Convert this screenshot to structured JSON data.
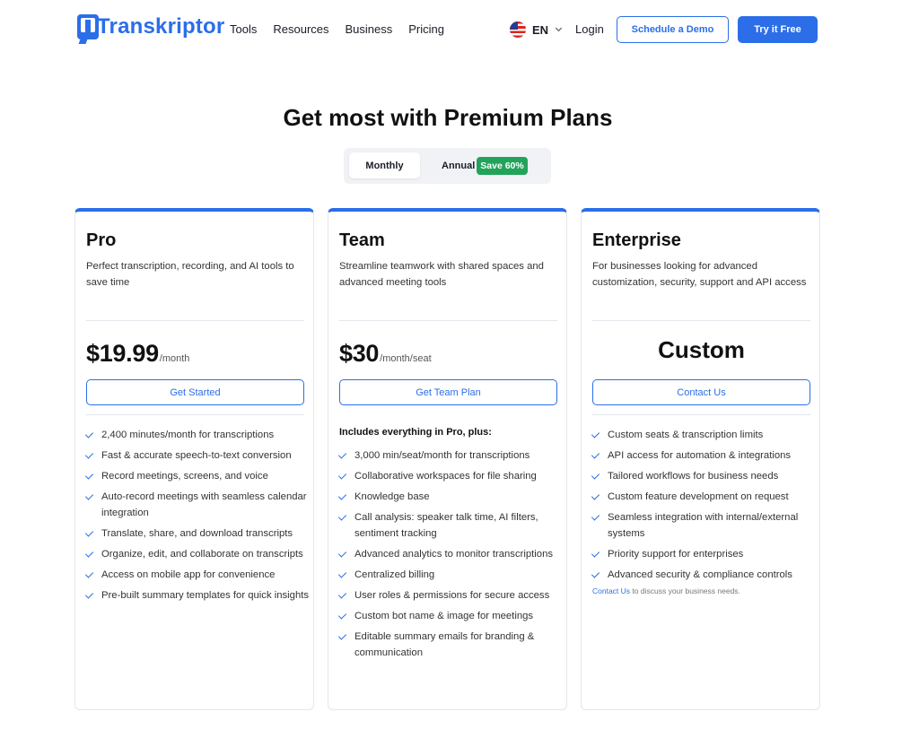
{
  "header": {
    "logo_text": "Transkriptor",
    "nav": [
      "Tools",
      "Resources",
      "Business",
      "Pricing"
    ],
    "language": "EN",
    "login": "Login",
    "demo_button": "Schedule a Demo",
    "try_button": "Try it Free",
    "accent_color": "#2b6ee8"
  },
  "hero": {
    "title": "Get most with Premium Plans",
    "toggle": {
      "monthly": "Monthly",
      "annual": "Annual",
      "save_badge": "Save 60%",
      "selected": "Monthly"
    }
  },
  "plans": [
    {
      "name": "Pro",
      "description": "Perfect transcription, recording, and AI tools to save time",
      "price": "$19.99",
      "unit": "/month",
      "cta": "Get Started",
      "features": [
        "2,400 minutes/month for transcriptions",
        "Fast & accurate speech-to-text conversion",
        "Record meetings, screens, and voice",
        "Auto-record meetings with seamless calendar integration",
        "Translate, share, and download transcripts",
        "Organize, edit, and collaborate on transcripts",
        "Access on mobile app for convenience",
        "Pre-built summary templates for quick insights"
      ]
    },
    {
      "name": "Team",
      "description": "Streamline teamwork with shared spaces and advanced meeting tools",
      "price": "$30",
      "unit": "/month/seat",
      "cta": "Get Team Plan",
      "features_intro": "Includes everything in Pro, plus:",
      "features": [
        "3,000 min/seat/month for transcriptions",
        "Collaborative workspaces for file sharing",
        "Knowledge base",
        "Call analysis: speaker talk time, AI filters, sentiment tracking",
        "Advanced analytics to monitor transcriptions",
        "Centralized billing",
        "User roles & permissions for secure access",
        "Custom bot name & image for meetings",
        "Editable summary emails for branding & communication"
      ]
    },
    {
      "name": "Enterprise",
      "description": "For businesses looking for advanced customization, security, support and API access",
      "price": "Custom",
      "cta": "Contact Us",
      "features": [
        "Custom seats & transcription limits",
        "API access for automation & integrations",
        "Tailored workflows for business needs",
        "Custom feature development on request",
        "Seamless integration with internal/external systems",
        "Priority support for enterprises",
        "Advanced security & compliance controls"
      ],
      "footnote_link": "Contact Us",
      "footnote_text": "to discuss your business needs."
    }
  ]
}
